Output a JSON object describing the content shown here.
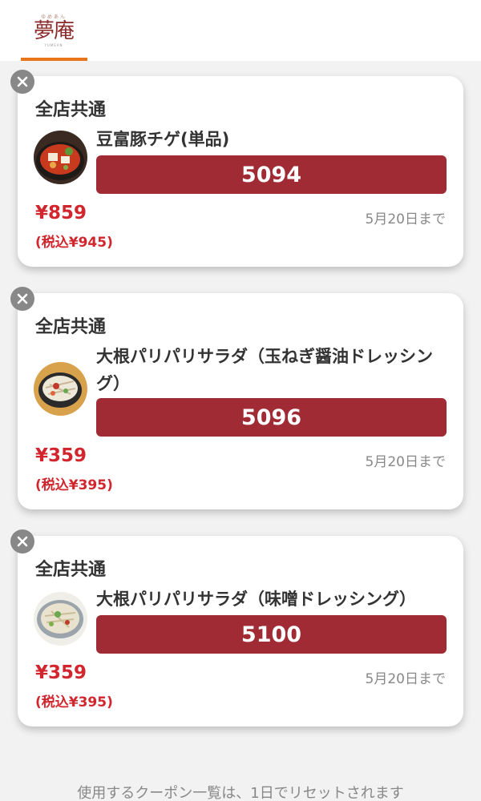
{
  "header": {
    "logo_text": "夢庵",
    "logo_ruby": "ゆめあん",
    "logo_sub": "YUMEAN"
  },
  "coupons": [
    {
      "area": "全店共通",
      "name": "豆富豚チゲ(単品)",
      "code": "5094",
      "price": "¥859",
      "price_tax": "(税込¥945)",
      "expiry": "5月20日まで",
      "thumb_icon": "tofu-pork-chige-dish-photo"
    },
    {
      "area": "全店共通",
      "name": "大根パリパリサラダ（玉ねぎ醤油ドレッシング）",
      "code": "5096",
      "price": "¥359",
      "price_tax": "(税込¥395)",
      "expiry": "5月20日まで",
      "thumb_icon": "daikon-salad-onion-dressing-photo"
    },
    {
      "area": "全店共通",
      "name": "大根パリパリサラダ（味噌ドレッシング）",
      "code": "5100",
      "price": "¥359",
      "price_tax": "(税込¥395)",
      "expiry": "5月20日まで",
      "thumb_icon": "daikon-salad-miso-dressing-photo"
    }
  ],
  "footer_note": "使用するクーポン一覧は、1日でリセットされます",
  "colors": {
    "accent_tab": "#e8751a",
    "code_button": "#a02b35",
    "price": "#d2262e"
  }
}
